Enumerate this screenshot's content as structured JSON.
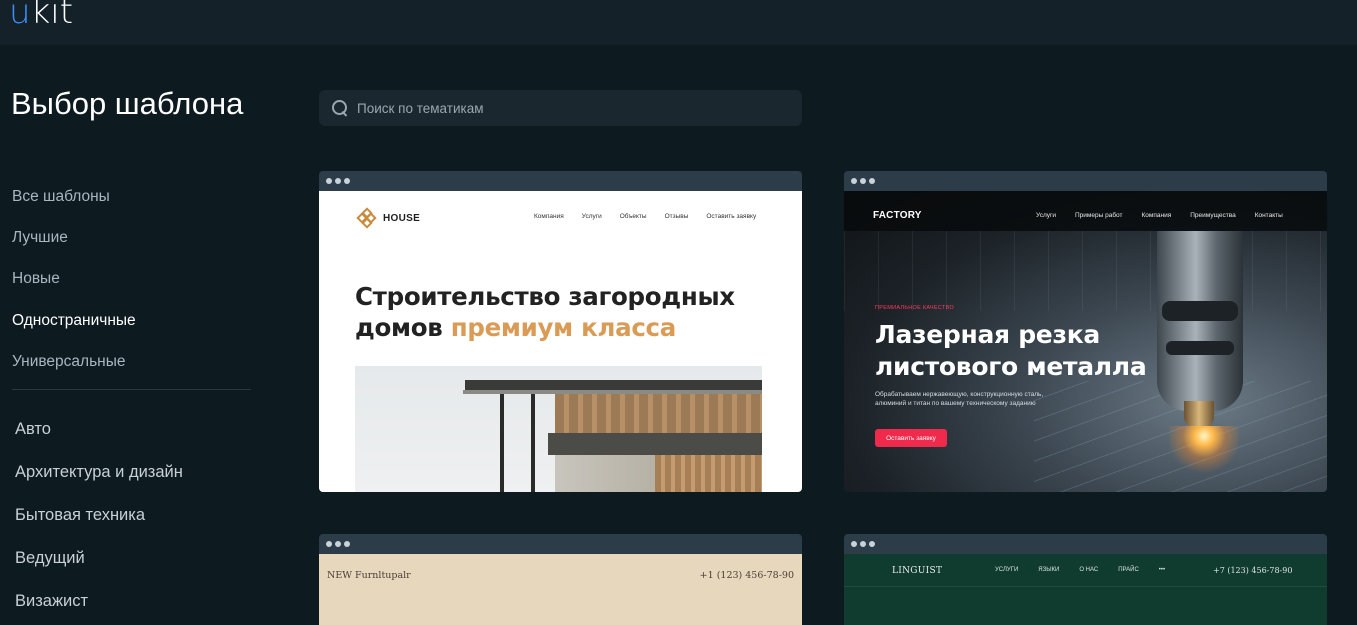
{
  "app": {
    "logo_u": "u",
    "logo_rest": "kit"
  },
  "page": {
    "title": "Выбор шаблона"
  },
  "search": {
    "placeholder": "Поиск по тематикам"
  },
  "sidebar": {
    "filters": [
      {
        "label": "Все шаблоны"
      },
      {
        "label": "Лучшие"
      },
      {
        "label": "Новые"
      },
      {
        "label": "Одностраничные",
        "active": true
      },
      {
        "label": "Универсальные"
      }
    ],
    "categories": [
      {
        "label": "Авто"
      },
      {
        "label": "Архитектура и дизайн"
      },
      {
        "label": "Бытовая техника"
      },
      {
        "label": "Ведущий"
      },
      {
        "label": "Визажист"
      }
    ]
  },
  "templates": {
    "house": {
      "brand": "HOUSE",
      "nav": [
        "Компания",
        "Услуги",
        "Объекты",
        "Отзывы",
        "Оставить заявку"
      ],
      "headline_1": "Строительство загородных",
      "headline_2": "домов ",
      "headline_accent": "премиум класса",
      "accent_color": "#d99b55"
    },
    "factory": {
      "brand": "FACTORY",
      "nav": [
        "Услуги",
        "Примеры работ",
        "Компания",
        "Преимущества",
        "Контакты"
      ],
      "kicker": "ПРЕМИАЛЬНОЕ КАЧЕСТВО",
      "headline_1": "Лазерная резка",
      "headline_2": "листового металла",
      "subtitle": "Обрабатываем нержавеющую, конструкционную сталь, алюминий и титан по вашему техническому заданию",
      "button": "Оставить заявку",
      "accent_color": "#ef2a4d"
    },
    "furniture": {
      "brand": "NEW Furnltupalr",
      "phone": "+1 (123) 456-78-90"
    },
    "linguist": {
      "brand": "LINGUIST",
      "nav": [
        "УСЛУГИ",
        "ЯЗЫКИ",
        "О НАС",
        "ПРАЙС",
        "•••"
      ],
      "phone": "+7 (123) 456-78-90"
    }
  }
}
